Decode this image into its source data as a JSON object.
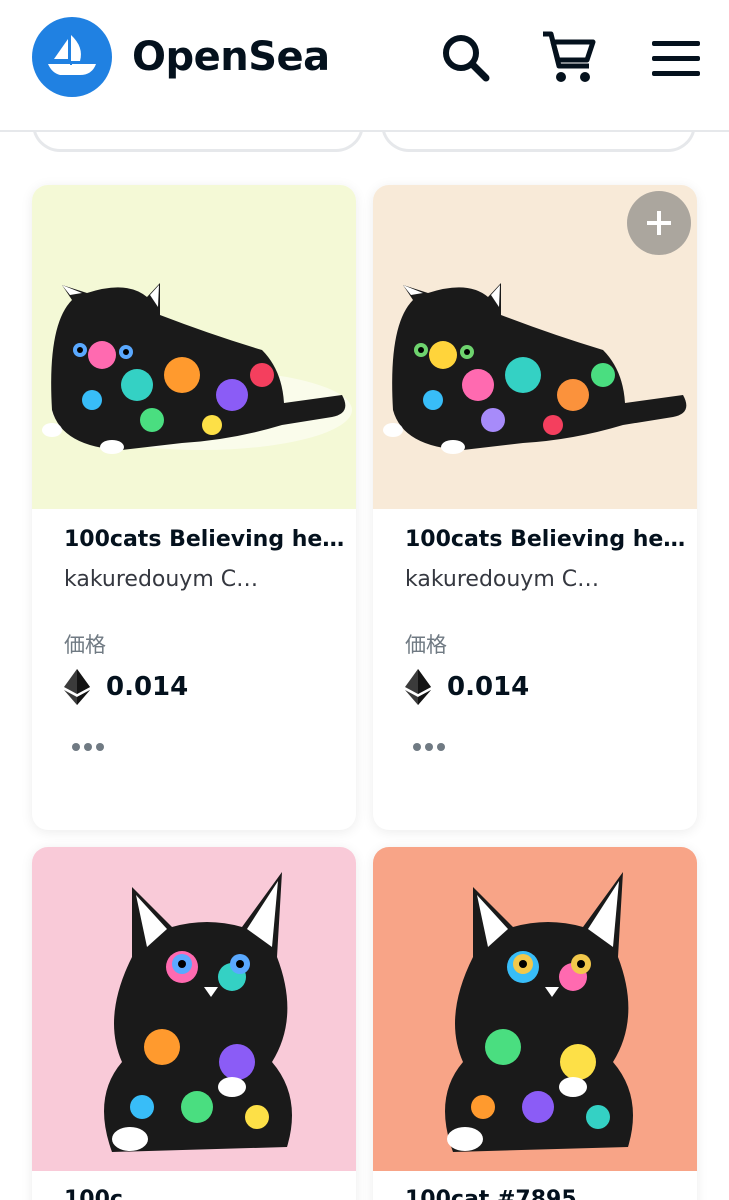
{
  "header": {
    "brand": "OpenSea",
    "icons": [
      "sailboat-logo-icon",
      "search-icon",
      "cart-icon",
      "menu-icon"
    ]
  },
  "cards": [
    {
      "title": "100cats Believing he…",
      "creator": "kakuredouym C…",
      "price_label": "価格",
      "price": "0.014",
      "bg": "#f4f9d6",
      "pose": "lying",
      "eye_color": "#5aa9ff"
    },
    {
      "title": "100cats Believing he…",
      "creator": "kakuredouym C…",
      "price_label": "価格",
      "price": "0.014",
      "bg": "#f8ead8",
      "pose": "lying",
      "eye_color": "#6ed36e"
    },
    {
      "title_peek": "100c",
      "bg": "#f9cad8",
      "pose": "sitting",
      "eye_color": "#5aa9ff"
    },
    {
      "title_peek": "100cat #7895",
      "bg": "#f8a487",
      "pose": "sitting",
      "eye_color": "#f2c84b"
    }
  ],
  "colors": {
    "brand_blue": "#2081e2",
    "text_dark": "#04111d",
    "text_muted": "#707a83",
    "border": "#e6e8eb"
  }
}
